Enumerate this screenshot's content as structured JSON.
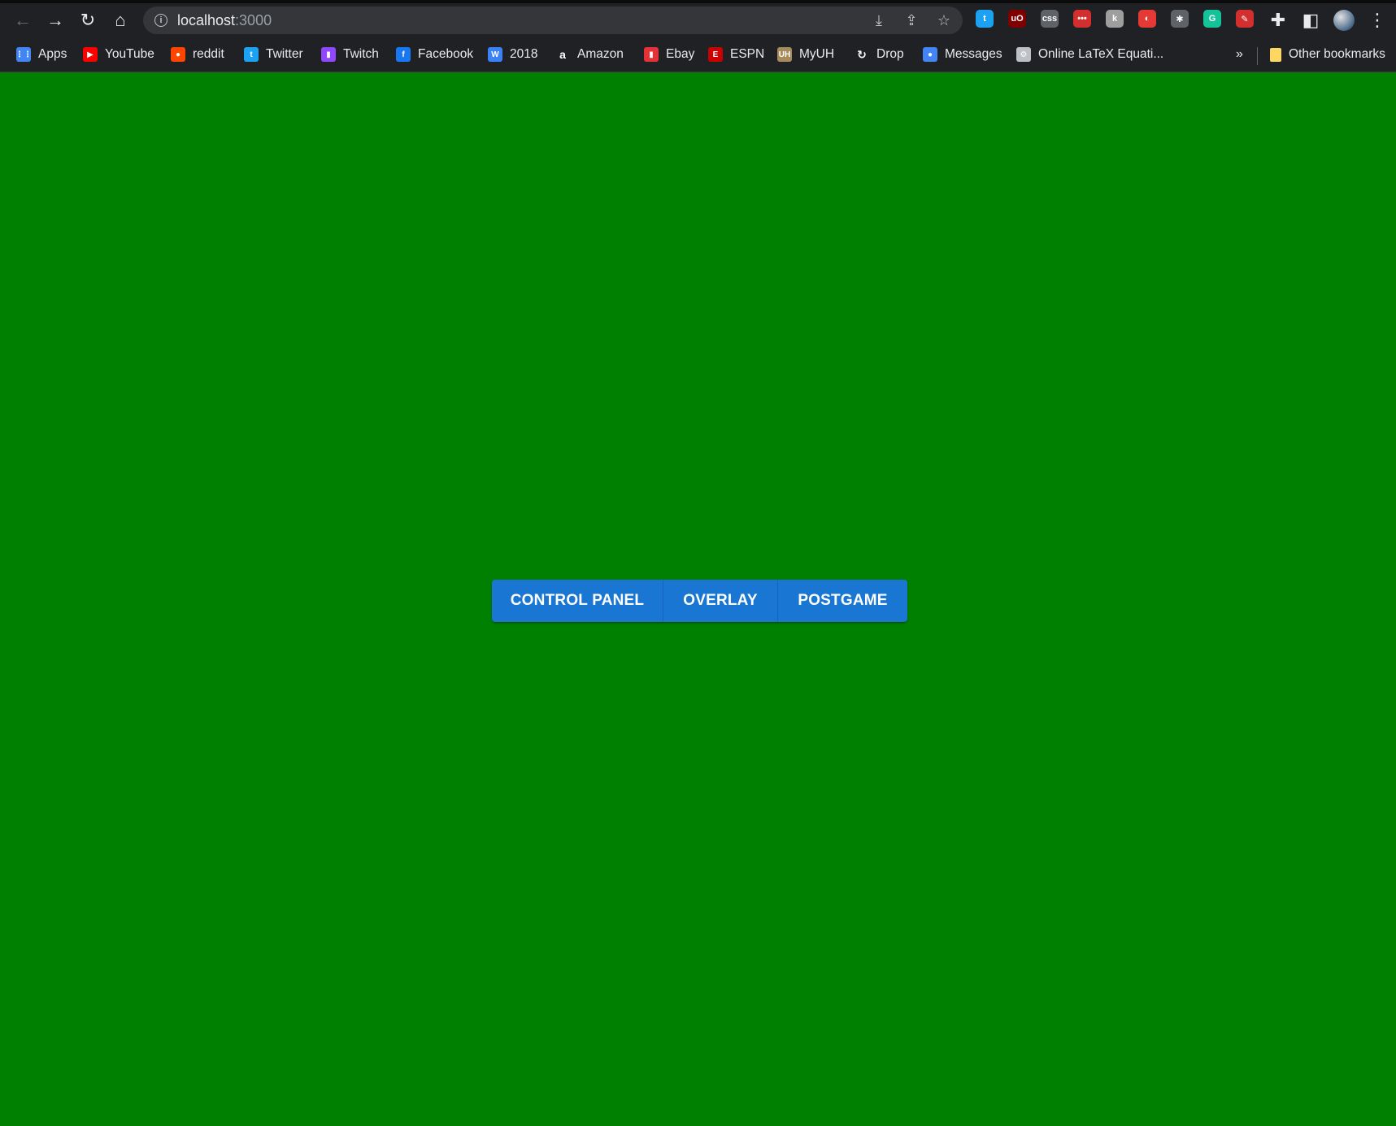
{
  "browser": {
    "url_host": "localhost",
    "url_port": ":3000",
    "extensions": [
      {
        "name": "twitter-extension-icon",
        "glyph": "t",
        "color": "#1da1f2"
      },
      {
        "name": "ublock-extension-icon",
        "glyph": "uO",
        "color": "#800000"
      },
      {
        "name": "css-extension-icon",
        "glyph": "css",
        "color": "#5f6368"
      },
      {
        "name": "dots-extension-icon",
        "glyph": "•••",
        "color": "#d32f2f"
      },
      {
        "name": "k-extension-icon",
        "glyph": "k",
        "color": "#9e9e9e"
      },
      {
        "name": "red-circle-extension-icon",
        "glyph": "◐",
        "color": "#e53935"
      },
      {
        "name": "bee-extension-icon",
        "glyph": "✱",
        "color": "#5f6368"
      },
      {
        "name": "grammarly-extension-icon",
        "glyph": "G",
        "color": "#15c39a"
      },
      {
        "name": "magic-wand-extension-icon",
        "glyph": "✎",
        "color": "#d32f2f"
      }
    ]
  },
  "bookmarks": {
    "items": [
      {
        "label": "Apps",
        "icon": "apps-grid-icon",
        "color": "#4285f4"
      },
      {
        "label": "YouTube",
        "icon": "youtube-icon",
        "color": "#ff0000"
      },
      {
        "label": "reddit",
        "icon": "reddit-icon",
        "color": "#ff4500"
      },
      {
        "label": "Twitter",
        "icon": "twitter-icon",
        "color": "#1da1f2"
      },
      {
        "label": "Twitch",
        "icon": "twitch-icon",
        "color": "#9146ff"
      },
      {
        "label": "Facebook",
        "icon": "facebook-icon",
        "color": "#1877f2"
      },
      {
        "label": "2018",
        "icon": "w-icon",
        "color": "#3b82f6"
      },
      {
        "label": "Amazon",
        "icon": "amazon-icon",
        "color": "#ffffff"
      },
      {
        "label": "Ebay",
        "icon": "ebay-icon",
        "color": "#e53238"
      },
      {
        "label": "ESPN",
        "icon": "espn-icon",
        "color": "#cc0000"
      },
      {
        "label": "MyUH",
        "icon": "myuh-icon",
        "color": "#a88b5a"
      },
      {
        "label": "Drop",
        "icon": "drop-icon",
        "color": "#ffffff"
      },
      {
        "label": "Messages",
        "icon": "messages-icon",
        "color": "#4285f4"
      },
      {
        "label": "Online LaTeX Equati...",
        "icon": "gear-icon",
        "color": "#bdc1c6"
      }
    ],
    "other_label": "Other bookmarks"
  },
  "buttons": {
    "control_panel": "CONTROL PANEL",
    "overlay": "OVERLAY",
    "postgame": "POSTGAME"
  },
  "colors": {
    "page_background": "#008000",
    "button_primary": "#1976d2"
  }
}
